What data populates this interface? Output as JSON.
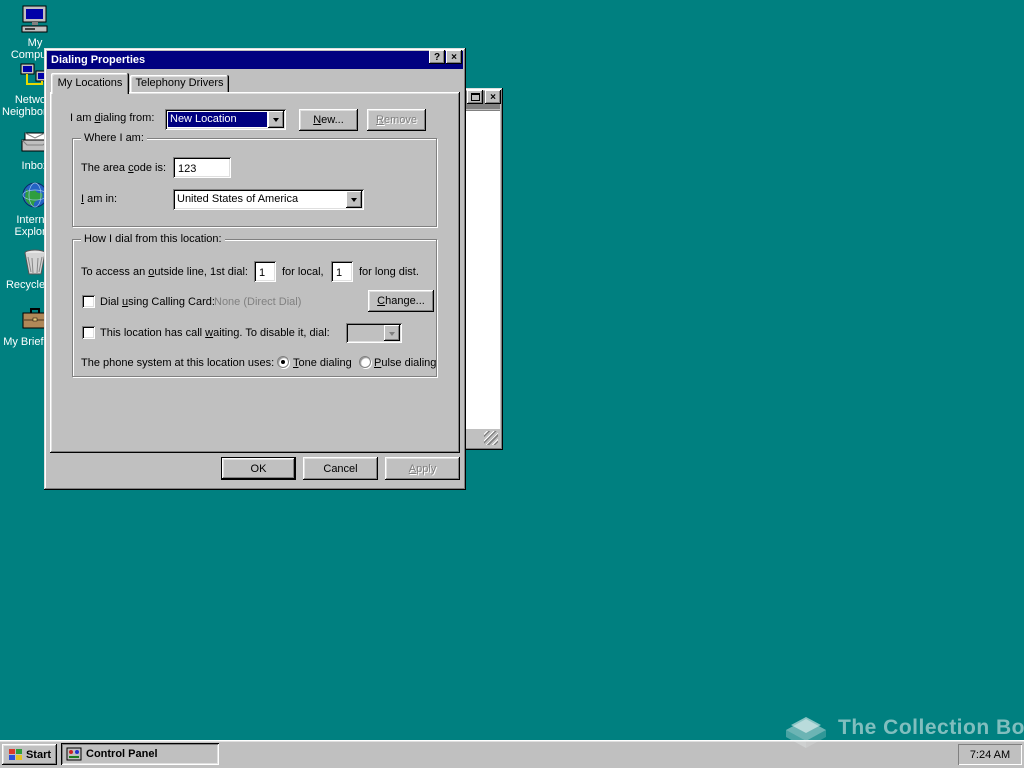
{
  "desktop": {
    "background_color": "#008080",
    "icons": [
      {
        "label": "My Computer"
      },
      {
        "label": "Network Neighborhood"
      },
      {
        "label": "Inbox"
      },
      {
        "label": "Internet Explorer"
      },
      {
        "label": "Recycle Bin"
      },
      {
        "label": "My Briefcase"
      }
    ],
    "watermark_text": "The Collection Book"
  },
  "dialog": {
    "title": "Dialing Properties",
    "titlebar": {
      "help_glyph": "?",
      "close_glyph": "×"
    },
    "tabs": [
      {
        "label": "My Locations"
      },
      {
        "label": "Telephony Drivers"
      }
    ],
    "dialing_from": {
      "label": "I am dialing from:",
      "selected": "New Location",
      "new_button": "New...",
      "remove_button": "Remove"
    },
    "where_i_am": {
      "legend": "Where I am:",
      "area_code_label": "The area code is:",
      "area_code_value": "123",
      "country_label": "I am in:",
      "country_value": "United States of America"
    },
    "how_i_dial": {
      "legend": "How I dial from this location:",
      "outside_line_label": "To access an outside line, 1st dial:",
      "local_value": "1",
      "local_suffix": "for local,",
      "long_dist_value": "1",
      "long_dist_suffix": "for long dist.",
      "calling_card_label": "Dial using Calling Card:",
      "calling_card_value": "None (Direct Dial)",
      "change_button": "Change...",
      "call_waiting_label": "This location has call waiting. To disable it, dial:",
      "phone_system_label": "The phone system at this location uses:",
      "tone_radio": "Tone dialing",
      "pulse_radio": "Pulse dialing"
    },
    "buttons": {
      "ok": "OK",
      "cancel": "Cancel",
      "apply": "Apply"
    },
    "background_window_close_glyph": "×"
  },
  "taskbar": {
    "start_label": "Start",
    "tasks": [
      {
        "label": "Control Panel"
      }
    ],
    "clock": "7:24 AM"
  }
}
